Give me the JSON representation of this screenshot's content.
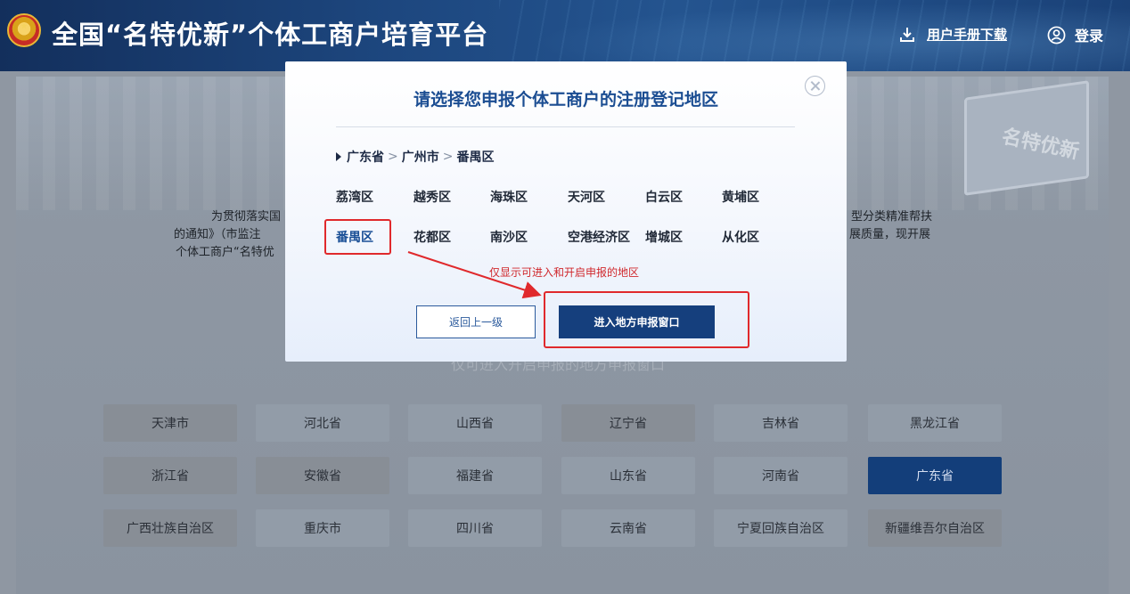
{
  "header": {
    "site_title": "全国“名特优新”个体工商户培育平台",
    "manual_label": "用户手册下载",
    "login_label": "登录"
  },
  "background": {
    "intro_left_lines": [
      "为贯彻落实国",
      "的通知》（市监注",
      "个体工商户“名特优"
    ],
    "intro_right_lines": [
      "型分类精准帮扶",
      "展质量，现开展"
    ],
    "illustration_text": "名特优新",
    "hint": "仅可进入开启申报的地方申报窗口",
    "provinces": [
      {
        "label": "天津市",
        "state": "dark"
      },
      {
        "label": "河北省",
        "state": "light"
      },
      {
        "label": "山西省",
        "state": "light"
      },
      {
        "label": "辽宁省",
        "state": "dark"
      },
      {
        "label": "吉林省",
        "state": "light"
      },
      {
        "label": "黑龙江省",
        "state": "light"
      },
      {
        "label": "浙江省",
        "state": "dark"
      },
      {
        "label": "安徽省",
        "state": "dark"
      },
      {
        "label": "福建省",
        "state": "light"
      },
      {
        "label": "山东省",
        "state": "light"
      },
      {
        "label": "河南省",
        "state": "light"
      },
      {
        "label": "广东省",
        "state": "active"
      },
      {
        "label": "广西壮族自治区",
        "state": "dark"
      },
      {
        "label": "重庆市",
        "state": "light"
      },
      {
        "label": "四川省",
        "state": "light"
      },
      {
        "label": "云南省",
        "state": "light"
      },
      {
        "label": "宁夏回族自治区",
        "state": "light"
      },
      {
        "label": "新疆维吾尔自治区",
        "state": "dark"
      }
    ]
  },
  "modal": {
    "title": "请选择您申报个体工商户的注册登记地区",
    "breadcrumb": [
      "广东省",
      "广州市",
      "番禺区"
    ],
    "breadcrumb_separator": ">",
    "districts": [
      "荔湾区",
      "越秀区",
      "海珠区",
      "天河区",
      "白云区",
      "黄埔区",
      "番禺区",
      "花都区",
      "南沙区",
      "空港经济区",
      "增城区",
      "从化区"
    ],
    "selected_district": "番禺区",
    "note": "仅显示可进入和开启申报的地区",
    "back_button": "返回上一级",
    "enter_button": "进入地方申报窗口"
  },
  "colors": {
    "brand_blue": "#153f7d",
    "title_blue": "#1b4d92",
    "annotation_red": "#e0292c"
  }
}
